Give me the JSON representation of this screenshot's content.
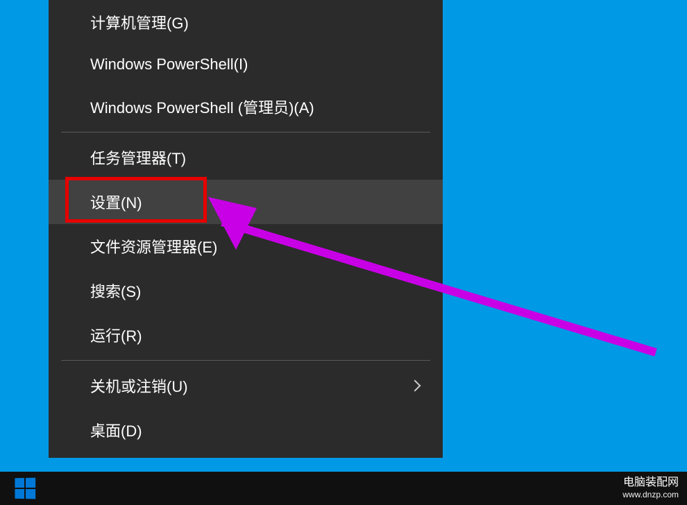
{
  "menu": {
    "items": [
      {
        "label": "计算机管理(G)"
      },
      {
        "label": "Windows PowerShell(I)"
      },
      {
        "label": "Windows PowerShell (管理员)(A)"
      },
      {
        "label": "任务管理器(T)"
      },
      {
        "label": "设置(N)"
      },
      {
        "label": "文件资源管理器(E)"
      },
      {
        "label": "搜索(S)"
      },
      {
        "label": "运行(R)"
      },
      {
        "label": "关机或注销(U)"
      },
      {
        "label": "桌面(D)"
      }
    ]
  },
  "watermark": {
    "cn": "电脑装配网",
    "en": "www.dnzp.com"
  },
  "annotations": {
    "highlight_color": "#e60000",
    "arrow_color": "#c800e6"
  }
}
